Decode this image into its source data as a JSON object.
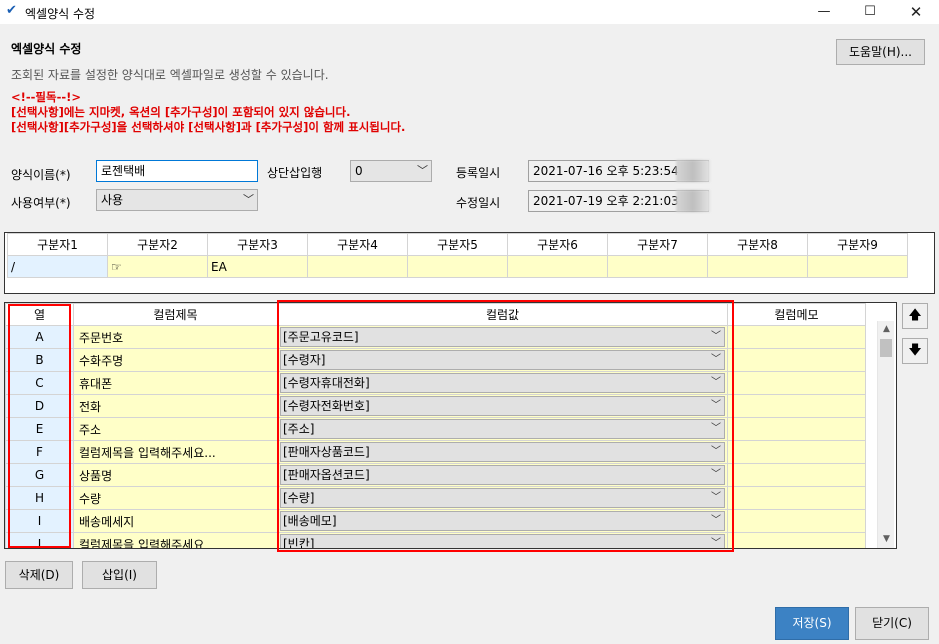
{
  "window": {
    "title": "엑셀양식 수정",
    "check_icon": "checkmark-icon",
    "min_symbol": "—",
    "max_symbol": "☐",
    "close_symbol": "✕"
  },
  "header": {
    "title": "엑셀양식 수정",
    "description": "조회된 자료를 설정한 양식대로 엑셀파일로 생성할 수 있습니다.",
    "help_label": "도움말(H)..."
  },
  "notices": [
    "<!--필독--!>",
    "[선택사항]에는 지마켓, 옥션의 [추가구성]이 포함되어 있지 않습니다.",
    "[선택사항][추가구성]을 선택하셔야 [선택사항]과 [추가구성]이 함께 표시됩니다."
  ],
  "form": {
    "name_label": "양식이름(*)",
    "name_value": "로젠택배",
    "use_label": "사용여부(*)",
    "use_value": "사용",
    "top_rows_label": "상단삽입행",
    "top_rows_value": "0",
    "registered_label": "등록일시",
    "registered_value": "2021-07-16 오후 5:23:54 (",
    "modified_label": "수정일시",
    "modified_value": "2021-07-19 오후 2:21:03 ("
  },
  "dividers": {
    "headers": [
      "구분자1",
      "구분자2",
      "구분자3",
      "구분자4",
      "구분자5",
      "구분자6",
      "구분자7",
      "구분자8",
      "구분자9"
    ],
    "values": [
      "/",
      "☞",
      "EA",
      "",
      "",
      "",
      "",
      "",
      ""
    ]
  },
  "columns": {
    "headers": {
      "col": "열",
      "title": "컬럼제목",
      "value": "컬럼값",
      "memo": "컬럼메모"
    },
    "rows": [
      {
        "col": "A",
        "title": "주문번호",
        "value": "[주문고유코드]"
      },
      {
        "col": "B",
        "title": "수화주명",
        "value": "[수령자]"
      },
      {
        "col": "C",
        "title": "휴대폰",
        "value": "[수령자휴대전화]"
      },
      {
        "col": "D",
        "title": "전화",
        "value": "[수령자전화번호]"
      },
      {
        "col": "E",
        "title": "주소",
        "value": "[주소]"
      },
      {
        "col": "F",
        "title": "컬럼제목을 입력해주세요...",
        "value": "[판매자상품코드]"
      },
      {
        "col": "G",
        "title": "상품명",
        "value": "[판매자옵션코드]"
      },
      {
        "col": "H",
        "title": "수량",
        "value": "[수량]"
      },
      {
        "col": "I",
        "title": "배송메세지",
        "value": "[배송메모]"
      },
      {
        "col": "J",
        "title": "컬럼제목을 입력해주세요",
        "value": "[빈칸]"
      }
    ]
  },
  "side_buttons": {
    "up": "🡅",
    "down": "🡇"
  },
  "footer": {
    "delete_label": "삭제(D)",
    "insert_label": "삽입(I)",
    "save_label": "저장(S)",
    "close_label": "닫기(C)"
  }
}
